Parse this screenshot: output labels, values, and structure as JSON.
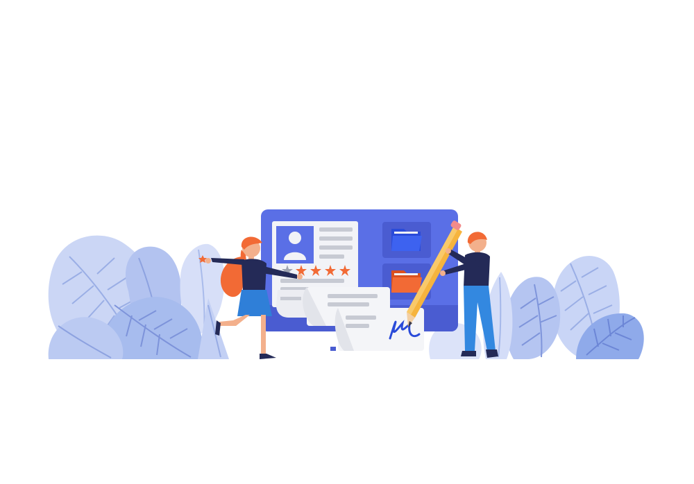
{
  "illustration": {
    "subject": "profile-rating-and-document-signing",
    "rating": {
      "filled_stars": 4,
      "total_stars": 5
    },
    "colors": {
      "background": "#ffffff",
      "board": "#5A6FE6",
      "board_shadow": "#4A5CD1",
      "leaf_light": "#C9D4F5",
      "leaf_mid": "#A9BCEE",
      "leaf_vein": "#7D93DA",
      "paper": "#F2F3F7",
      "paper_line": "#C7CAD3",
      "folder_blue": "#2A4BD9",
      "folder_orange": "#F26A35",
      "star": "#F26A35",
      "star_empty": "#9EA3B0",
      "hair": "#F26A35",
      "skin": "#F3B08C",
      "shirt": "#242A57",
      "skirt": "#2F7FD8",
      "pants": "#3388E0",
      "pencil": "#F6B43E",
      "signature": "#2A4BD9"
    }
  }
}
